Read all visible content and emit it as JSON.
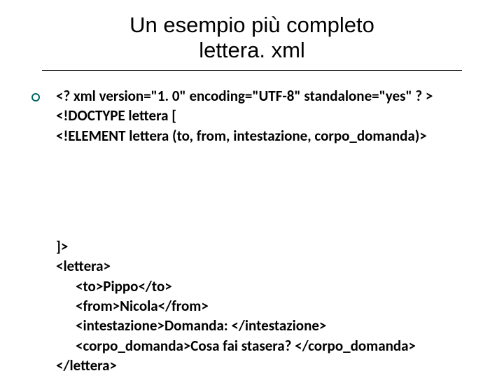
{
  "title": {
    "line1": "Un esempio più completo",
    "line2": "lettera. xml"
  },
  "code_block_top": {
    "l1": "<? xml version=\"1. 0\" encoding=\"UTF-8\" standalone=\"yes\" ? >",
    "l2": "<!DOCTYPE lettera [",
    "l3": "<!ELEMENT lettera (to, from, intestazione, corpo_domanda)>"
  },
  "code_block_bottom": {
    "l1": "]>",
    "l2": "<lettera>",
    "l3": "<to>Pippo</to>",
    "l4": "<from>Nicola</from>",
    "l5": "<intestazione>Domanda: </intestazione>",
    "l6": "<corpo_domanda>Cosa fai stasera? </corpo_domanda>",
    "l7": "</lettera>"
  }
}
